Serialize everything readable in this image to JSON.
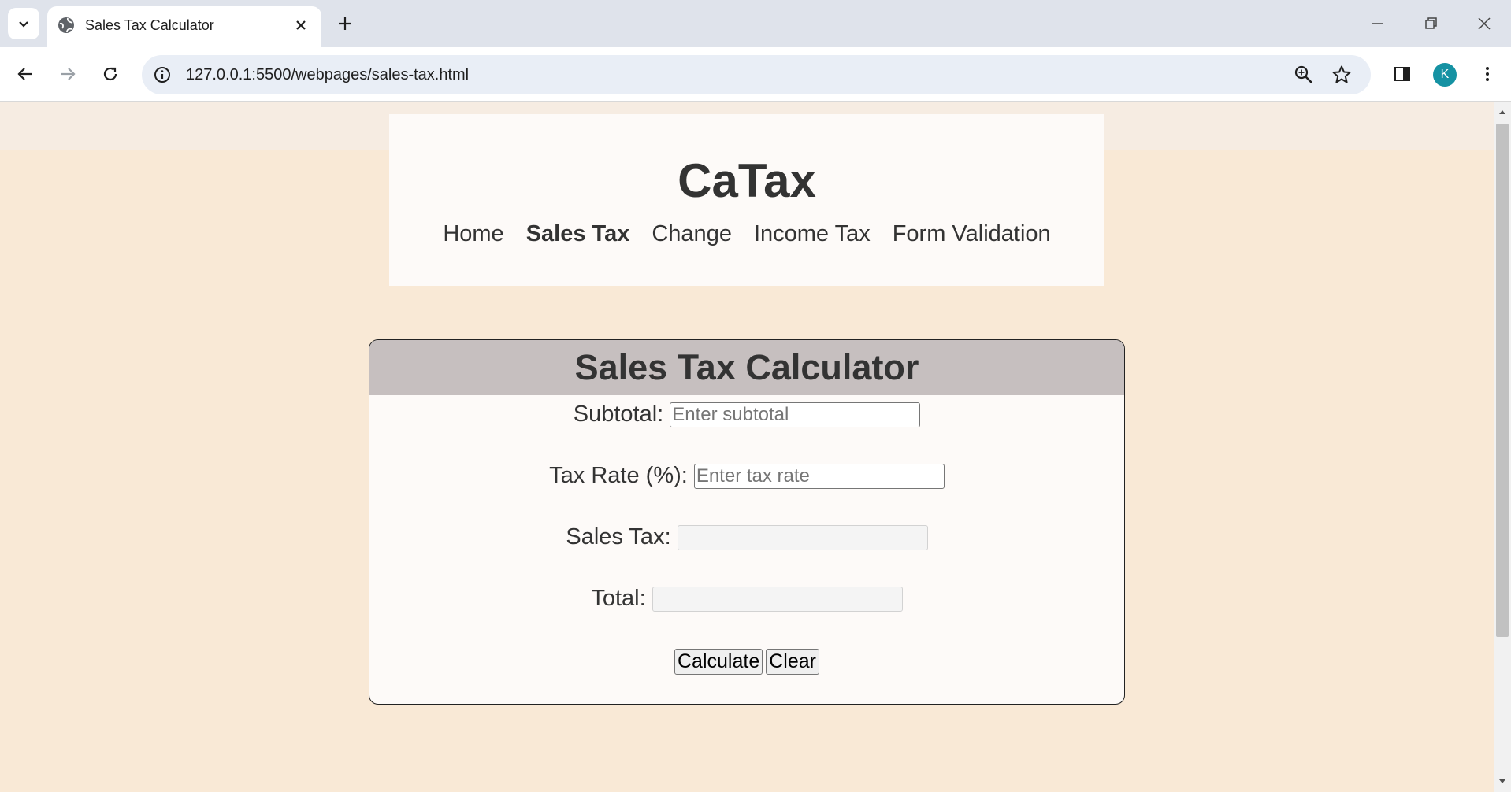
{
  "browser": {
    "tab_title": "Sales Tax Calculator",
    "url": "127.0.0.1:5500/webpages/sales-tax.html",
    "avatar_letter": "K"
  },
  "header": {
    "site_title": "CaTax",
    "nav": [
      {
        "label": "Home",
        "active": false
      },
      {
        "label": "Sales Tax",
        "active": true
      },
      {
        "label": "Change",
        "active": false
      },
      {
        "label": "Income Tax",
        "active": false
      },
      {
        "label": "Form Validation",
        "active": false
      }
    ]
  },
  "calculator": {
    "title": "Sales Tax Calculator",
    "fields": [
      {
        "label": "Subtotal:",
        "value": "",
        "placeholder": "Enter subtotal"
      },
      {
        "label": "Tax Rate (%):",
        "value": "",
        "placeholder": "Enter tax rate"
      },
      {
        "label": "Sales Tax:",
        "value": "",
        "placeholder": ""
      },
      {
        "label": "Total:",
        "value": "",
        "placeholder": ""
      }
    ],
    "buttons": {
      "calculate": "Calculate",
      "clear": "Clear"
    }
  },
  "colors": {
    "page_bg": "#f9e9d6",
    "header_bg": "#fdfaf8",
    "calc_header_bg": "#c6bfbf",
    "avatar": "#1592a3"
  }
}
